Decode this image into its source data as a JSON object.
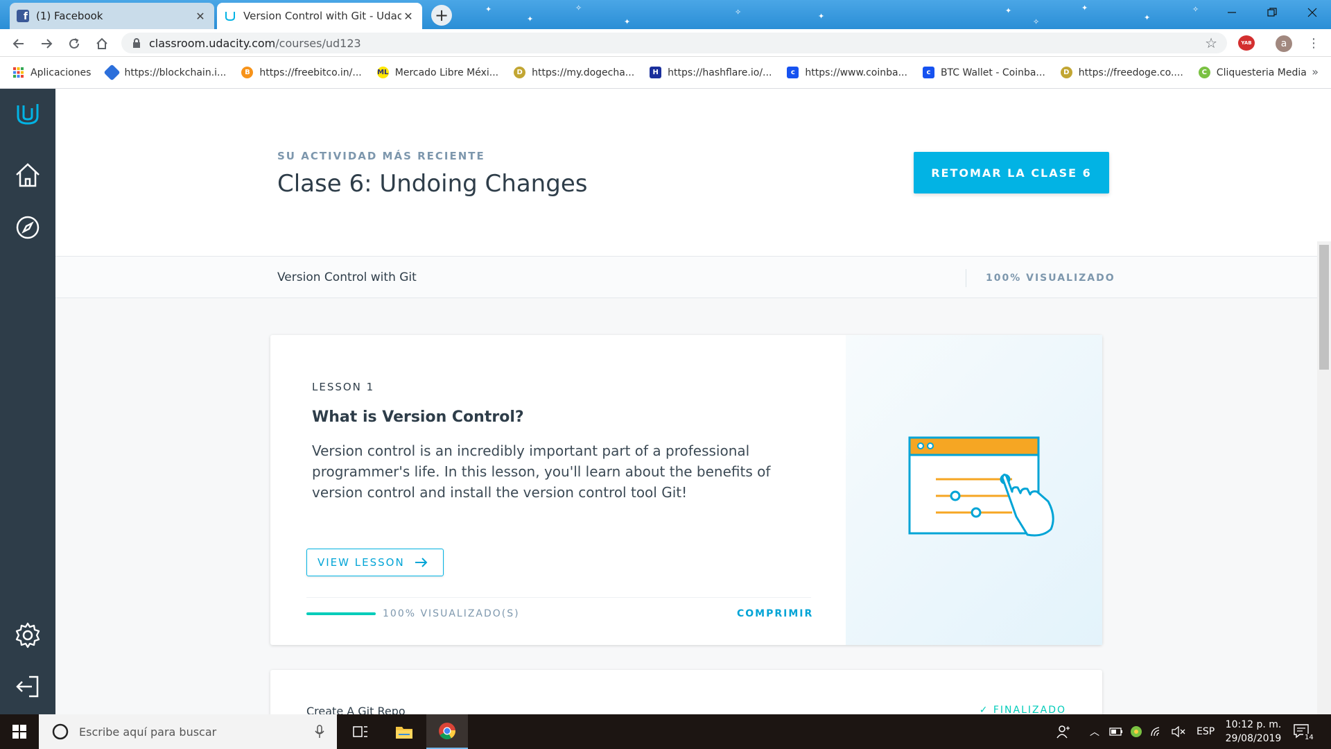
{
  "browser": {
    "tabs": [
      {
        "title": "(1) Facebook",
        "icon": "facebook-icon"
      },
      {
        "title": "Version Control with Git - Udacity",
        "icon": "udacity-icon"
      }
    ],
    "url_host": "classroom.udacity.com",
    "url_path": "/courses/ud123",
    "profile_initial": "a",
    "extension_badge": "YAB"
  },
  "bookmarks": [
    {
      "label": "Aplicaciones",
      "icon": "apps-grid-icon",
      "color": "#ea4335"
    },
    {
      "label": "https://blockchain.i...",
      "icon": "blockchain-icon",
      "color": "#2c6fdb"
    },
    {
      "label": "https://freebitco.in/...",
      "icon": "bitcoin-icon",
      "color": "#f7931a"
    },
    {
      "label": "Mercado Libre Méxi...",
      "icon": "mercadolibre-icon",
      "color": "#ffe600"
    },
    {
      "label": "https://my.dogecha...",
      "icon": "doge-icon",
      "color": "#c2a633"
    },
    {
      "label": "https://hashflare.io/...",
      "icon": "hashflare-icon",
      "color": "#1a2f9c"
    },
    {
      "label": "https://www.coinba...",
      "icon": "coinbase-icon",
      "color": "#1652f0"
    },
    {
      "label": "BTC Wallet - Coinba...",
      "icon": "coinbase-icon",
      "color": "#1652f0"
    },
    {
      "label": "https://freedoge.co....",
      "icon": "doge-icon",
      "color": "#c2a633"
    },
    {
      "label": "Cliquesteria Media",
      "icon": "cliquesteria-icon",
      "color": "#7ac142"
    }
  ],
  "recent": {
    "kicker": "SU ACTIVIDAD MÁS RECIENTE",
    "title": "Clase 6: Undoing Changes",
    "resume_button": "RETOMAR LA CLASE 6"
  },
  "course": {
    "name": "Version Control with Git",
    "progress_label": "100% VISUALIZADO",
    "progress": 1.0
  },
  "lessons": [
    {
      "number_label": "LESSON 1",
      "title": "What is Version Control?",
      "description": "Version control is an incredibly important part of a professional programmer's life. In this lesson, you'll learn about the benefits of version control and install the version control tool Git!",
      "view_button": "VIEW LESSON",
      "progress": 1.0,
      "progress_label": "100% VISUALIZADO(S)",
      "collapse_label": "COMPRIMIR"
    },
    {
      "title": "Create A Git Repo",
      "status": "✓ FINALIZADO"
    }
  ],
  "taskbar": {
    "search_placeholder": "Escribe aquí para buscar",
    "language": "ESP",
    "time": "10:12 p. m.",
    "date": "29/08/2019",
    "notifications": "14"
  },
  "colors": {
    "accent": "#02b3e4",
    "sidebar": "#2e3d49",
    "progress": "#02ccba",
    "illustration_yellow": "#f6a623",
    "illustration_blue": "#02a4d6"
  }
}
